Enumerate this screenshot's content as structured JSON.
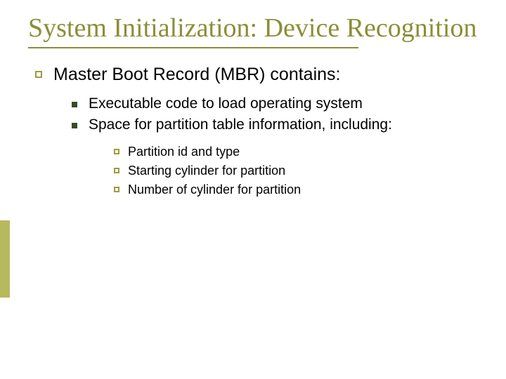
{
  "title": "System Initialization: Device Recognition",
  "l1": {
    "text": "Master Boot Record (MBR) contains:"
  },
  "l2": {
    "items": [
      "Executable code to load operating system",
      "Space for partition table information, including:"
    ]
  },
  "l3": {
    "items": [
      "Partition id and type",
      "Starting cylinder for partition",
      "Number of cylinder for partition"
    ]
  },
  "colors": {
    "accent": "#8b8e36",
    "sidebar": "#b7b95d",
    "square": "#394a26"
  }
}
